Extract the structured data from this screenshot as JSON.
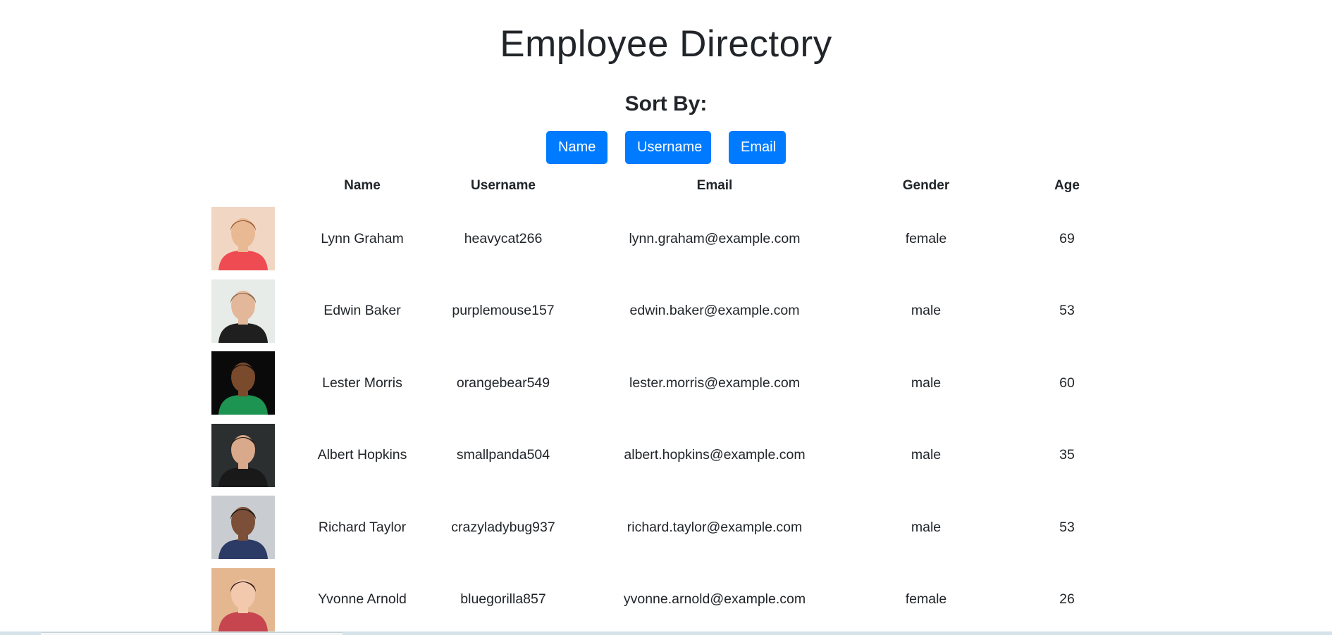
{
  "page": {
    "title": "Employee Directory",
    "sort_label": "Sort By:"
  },
  "sort_buttons": {
    "name_label": "Name",
    "username_label": "Username",
    "email_label": "Email"
  },
  "table": {
    "headers": {
      "photo": "",
      "name": "Name",
      "username": "Username",
      "email": "Email",
      "gender": "Gender",
      "age": "Age"
    },
    "rows": [
      {
        "name": "Lynn Graham",
        "username": "heavycat266",
        "email": "lynn.graham@example.com",
        "gender": "female",
        "age": "69",
        "photo": {
          "bg": "#f1d7c3",
          "skin": "#e9b994",
          "hair": "#a0623a",
          "shirt": "#ee4b52"
        }
      },
      {
        "name": "Edwin Baker",
        "username": "purplemouse157",
        "email": "edwin.baker@example.com",
        "gender": "male",
        "age": "53",
        "photo": {
          "bg": "#e8ece9",
          "skin": "#e3b79a",
          "hair": "#8a6a4c",
          "shirt": "#1f1f1f"
        }
      },
      {
        "name": "Lester Morris",
        "username": "orangebear549",
        "email": "lester.morris@example.com",
        "gender": "male",
        "age": "60",
        "photo": {
          "bg": "#0a0a0a",
          "skin": "#7a4a2c",
          "hair": "#141010",
          "shirt": "#1e9452"
        }
      },
      {
        "name": "Albert Hopkins",
        "username": "smallpanda504",
        "email": "albert.hopkins@example.com",
        "gender": "male",
        "age": "35",
        "photo": {
          "bg": "#2b2f30",
          "skin": "#d8a98a",
          "hair": "#2a1d15",
          "shirt": "#191919"
        }
      },
      {
        "name": "Richard Taylor",
        "username": "crazyladybug937",
        "email": "richard.taylor@example.com",
        "gender": "male",
        "age": "53",
        "photo": {
          "bg": "#c9ccd0",
          "skin": "#7b4f38",
          "hair": "#1d1410",
          "shirt": "#2c3a66"
        }
      },
      {
        "name": "Yvonne Arnold",
        "username": "bluegorilla857",
        "email": "yvonne.arnold@example.com",
        "gender": "female",
        "age": "26",
        "photo": {
          "bg": "#e4b790",
          "skin": "#f2c9ad",
          "hair": "#3a1d1b",
          "shirt": "#c7454f"
        }
      }
    ]
  }
}
